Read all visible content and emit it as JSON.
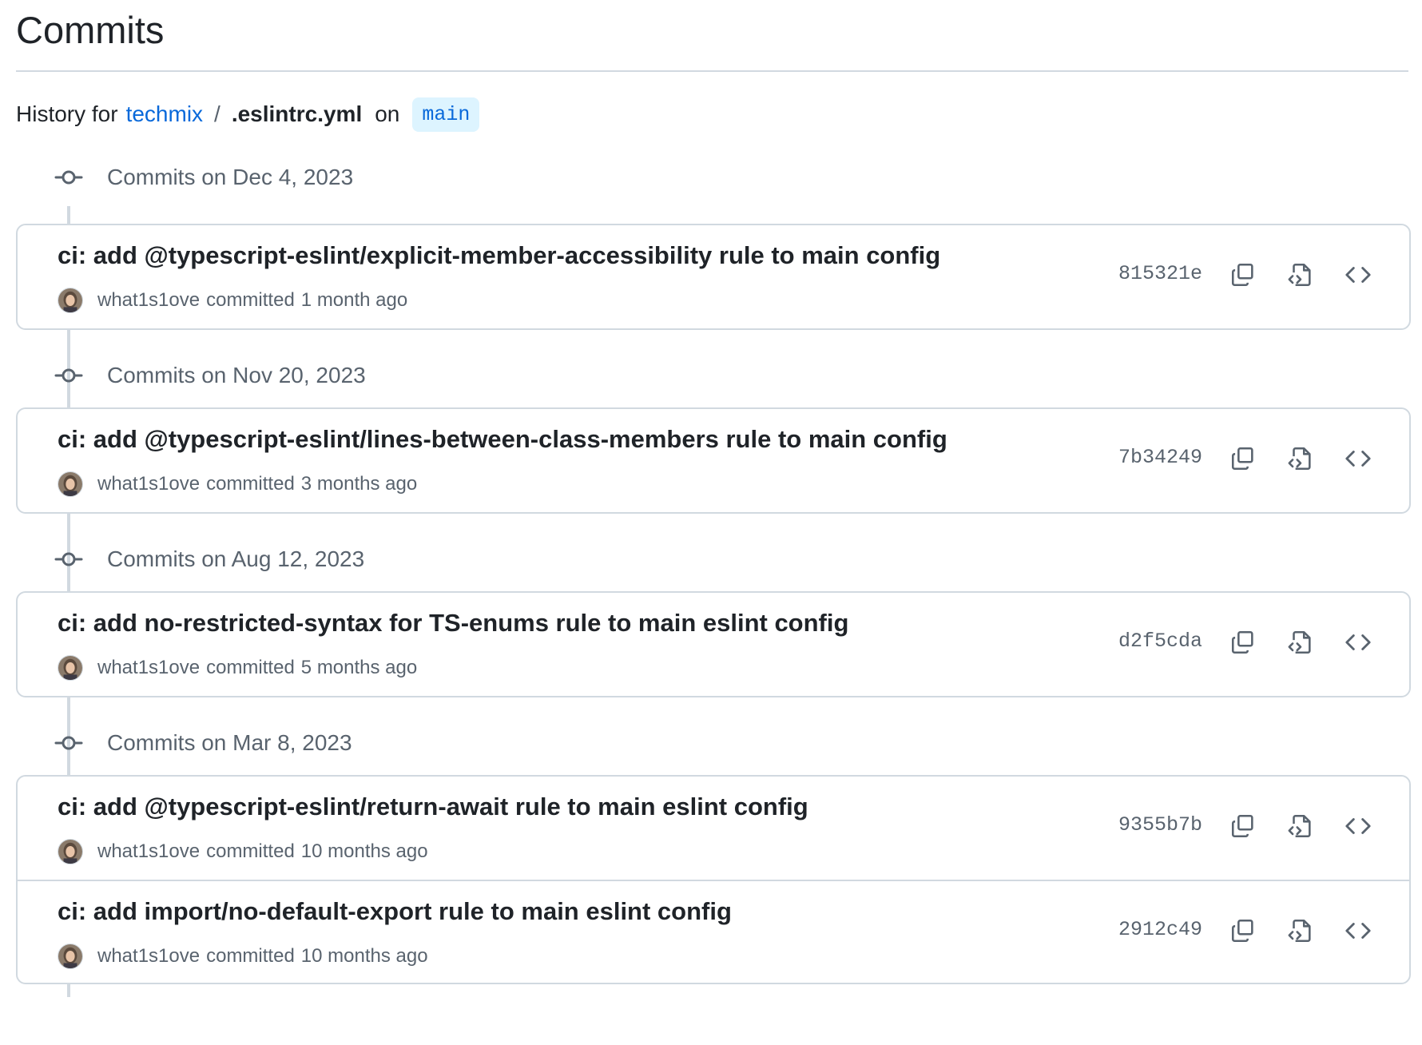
{
  "page": {
    "title": "Commits",
    "history_prefix": "History for",
    "repo": "techmix",
    "path_separator": "/",
    "file": ".eslintrc.yml",
    "on_label": "on",
    "branch": "main"
  },
  "groups": [
    {
      "date_label": "Commits on Dec 4, 2023",
      "commits": [
        {
          "message": "ci: add @typescript-eslint/explicit-member-accessibility rule to main config",
          "author": "what1s1ove",
          "verb": "committed",
          "when": "1 month ago",
          "sha": "815321e"
        }
      ]
    },
    {
      "date_label": "Commits on Nov 20, 2023",
      "commits": [
        {
          "message": "ci: add @typescript-eslint/lines-between-class-members rule to main config",
          "author": "what1s1ove",
          "verb": "committed",
          "when": "3 months ago",
          "sha": "7b34249"
        }
      ]
    },
    {
      "date_label": "Commits on Aug 12, 2023",
      "commits": [
        {
          "message": "ci: add no-restricted-syntax for TS-enums rule to main eslint config",
          "author": "what1s1ove",
          "verb": "committed",
          "when": "5 months ago",
          "sha": "d2f5cda"
        }
      ]
    },
    {
      "date_label": "Commits on Mar 8, 2023",
      "commits": [
        {
          "message": "ci: add @typescript-eslint/return-await rule to main eslint config",
          "author": "what1s1ove",
          "verb": "committed",
          "when": "10 months ago",
          "sha": "9355b7b"
        },
        {
          "message": "ci: add import/no-default-export rule to main eslint config",
          "author": "what1s1ove",
          "verb": "committed",
          "when": "10 months ago",
          "sha": "2912c49"
        }
      ]
    }
  ],
  "icons": {
    "commit_node": "git-commit-icon",
    "copy": "copy-icon",
    "browse": "file-code-icon",
    "code": "code-icon"
  },
  "colors": {
    "link": "#0969da",
    "branch_bg": "#ddf4ff",
    "muted_text": "#59636e",
    "border": "#d1d9e0"
  }
}
